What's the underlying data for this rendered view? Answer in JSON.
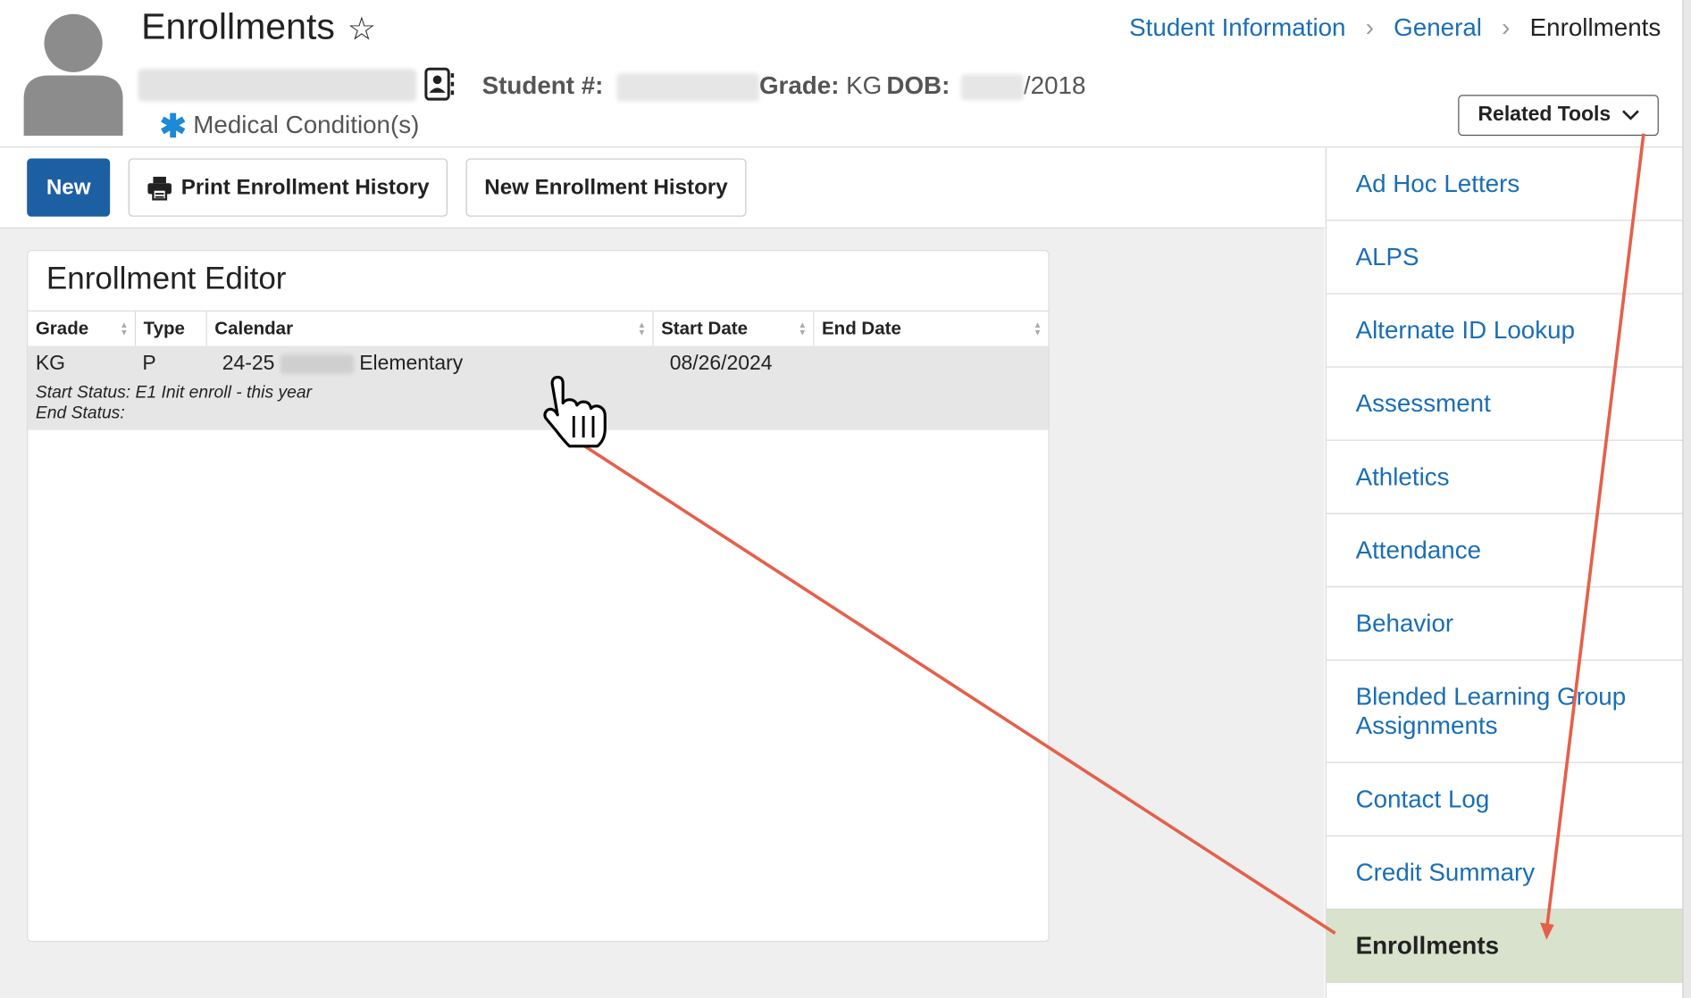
{
  "header": {
    "title": "Enrollments",
    "student_number_label": "Student #:",
    "grade_label": "Grade:",
    "grade_value": "KG",
    "dob_label": "DOB:",
    "dob_year": "/2018",
    "medical_label": "Medical Condition(s)"
  },
  "breadcrumb": [
    "Student Information",
    "General",
    "Enrollments"
  ],
  "related_tools_label": "Related Tools",
  "toolbar": {
    "new_label": "New",
    "print_label": "Print Enrollment History",
    "new_history_label": "New Enrollment History"
  },
  "editor": {
    "title": "Enrollment Editor",
    "columns": [
      "Grade",
      "Type",
      "Calendar",
      "Start Date",
      "End Date"
    ],
    "row": {
      "grade": "KG",
      "type": "P",
      "calendar_prefix": "24-25",
      "calendar_suffix": "Elementary",
      "start_date": "08/26/2024",
      "end_date": "",
      "start_status": "Start Status: E1 Init enroll - this year",
      "end_status": "End Status:"
    }
  },
  "sidebar": {
    "items": [
      {
        "label": "Ad Hoc Letters"
      },
      {
        "label": "ALPS"
      },
      {
        "label": "Alternate ID Lookup"
      },
      {
        "label": "Assessment"
      },
      {
        "label": "Athletics"
      },
      {
        "label": "Attendance"
      },
      {
        "label": "Behavior"
      },
      {
        "label": "Blended Learning Group Assignments"
      },
      {
        "label": "Contact Log"
      },
      {
        "label": "Credit Summary"
      },
      {
        "label": "Enrollments",
        "active": true
      }
    ]
  },
  "colors": {
    "link": "#1a6eb4",
    "primary_button": "#1d5fa3",
    "active_item": "#d9e2cc",
    "annotation_arrow": "#e5604a",
    "medical_asterisk": "#1c8ad6"
  },
  "icons": [
    "avatar-icon",
    "star-icon",
    "contact-card-icon",
    "asterisk-icon",
    "chevron-right-icon",
    "chevron-down-icon",
    "printer-icon",
    "sort-icon",
    "hand-pointer-cursor-icon",
    "annotation-arrow"
  ]
}
